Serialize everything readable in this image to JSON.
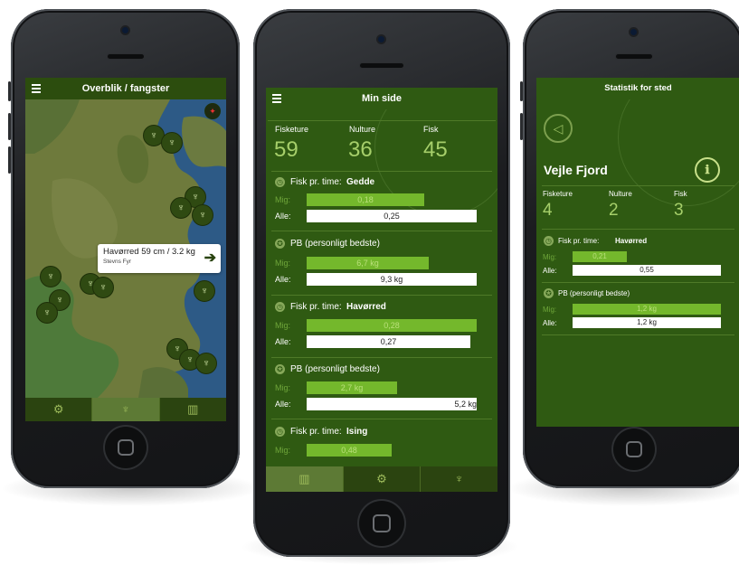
{
  "phone1": {
    "title": "Overblik / fangster",
    "callout_title": "Havørred 59 cm / 3.2 kg",
    "callout_subtitle": "Stevns Fyr"
  },
  "phone2": {
    "title": "Min side",
    "stats": [
      {
        "label": "Fisketure",
        "value": "59"
      },
      {
        "label": "Nulture",
        "value": "36"
      },
      {
        "label": "Fisk",
        "value": "45"
      }
    ],
    "sections": [
      {
        "header": "Fisk pr. time:",
        "species": "Gedde",
        "mig_label": "Mig:",
        "mig_value": "0,18",
        "alle_label": "Alle:",
        "alle_value": "0,25"
      },
      {
        "header": "PB (personligt bedste)",
        "species": "",
        "mig_label": "Mig:",
        "mig_value": "6,7 kg",
        "alle_label": "Alle:",
        "alle_value": "9,3 kg"
      },
      {
        "header": "Fisk pr. time:",
        "species": "Havørred",
        "mig_label": "Mig:",
        "mig_value": "0,28",
        "alle_label": "Alle:",
        "alle_value": "0,27"
      },
      {
        "header": "PB (personligt bedste)",
        "species": "",
        "mig_label": "Mig:",
        "mig_value": "2,7 kg",
        "alle_label": "Alle:",
        "alle_value": "5,2 kg"
      },
      {
        "header": "Fisk pr. time:",
        "species": "Ising",
        "mig_label": "Mig:",
        "mig_value": "0,48"
      }
    ]
  },
  "phone3": {
    "title": "Statistik for sted",
    "place": "Vejle Fjord",
    "stats": [
      {
        "label": "Fisketure",
        "value": "4"
      },
      {
        "label": "Nulture",
        "value": "2"
      },
      {
        "label": "Fisk",
        "value": "3"
      }
    ],
    "sections": [
      {
        "header": "Fisk pr. time:",
        "species": "Havørred",
        "mig_label": "Mig:",
        "mig_value": "0,21",
        "alle_label": "Alle:",
        "alle_value": "0,55"
      },
      {
        "header": "PB (personligt bedste)",
        "species": "",
        "mig_label": "Mig:",
        "mig_value": "1,2 kg",
        "alle_label": "Alle:",
        "alle_value": "1,2 kg"
      }
    ]
  },
  "colors": {
    "accent": "#74b82c",
    "background": "#2f5a12",
    "navbar": "#2c4d0e"
  },
  "icons": [
    "menu-icon",
    "compass-icon",
    "fish-pin-icon",
    "statistics-icon",
    "fish-icon",
    "angler-icon",
    "back-icon",
    "info-icon",
    "clock-icon",
    "medal-icon",
    "arrow-right-icon"
  ]
}
